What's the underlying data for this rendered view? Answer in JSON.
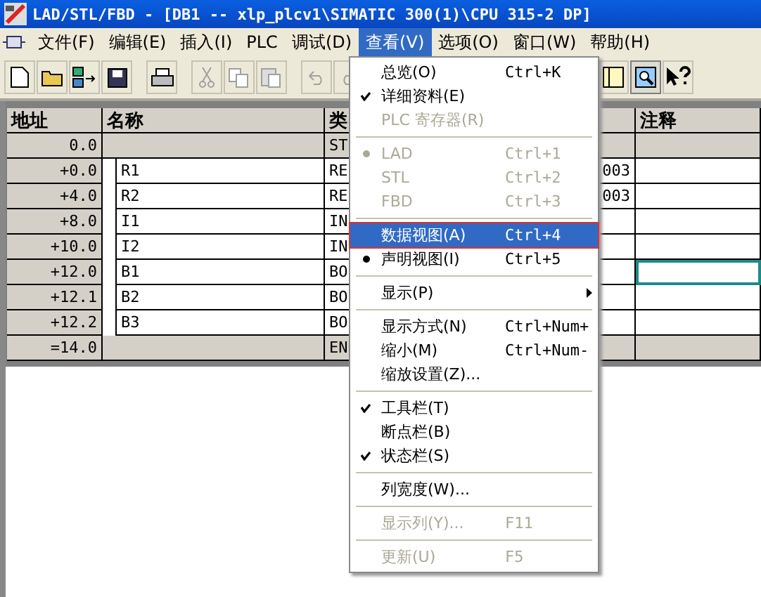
{
  "window": {
    "title": "LAD/STL/FBD  - [DB1 -- xlp_plcv1\\SIMATIC 300(1)\\CPU 315-2 DP]"
  },
  "menu_bar": [
    {
      "label": "文件(F)",
      "selected": false
    },
    {
      "label": "编辑(E)",
      "selected": false
    },
    {
      "label": "插入(I)",
      "selected": false
    },
    {
      "label": "PLC",
      "selected": false
    },
    {
      "label": "调试(D)",
      "selected": false
    },
    {
      "label": "查看(V)",
      "selected": true
    },
    {
      "label": "选项(O)",
      "selected": false
    },
    {
      "label": "窗口(W)",
      "selected": false
    },
    {
      "label": "帮助(H)",
      "selected": false
    }
  ],
  "toolbar": [
    {
      "kind": "new",
      "disabled": false
    },
    {
      "kind": "open",
      "disabled": false
    },
    {
      "kind": "download",
      "disabled": false
    },
    {
      "kind": "save",
      "disabled": false
    },
    {
      "kind": "gap"
    },
    {
      "kind": "print",
      "disabled": false
    },
    {
      "kind": "gap"
    },
    {
      "kind": "cut",
      "disabled": true
    },
    {
      "kind": "copy",
      "disabled": true
    },
    {
      "kind": "paste",
      "disabled": true
    },
    {
      "kind": "gap"
    },
    {
      "kind": "undo",
      "disabled": true
    },
    {
      "kind": "redo",
      "disabled": true
    }
  ],
  "toolbar_right": [
    {
      "kind": "panel",
      "pressed": false
    },
    {
      "kind": "zoom",
      "pressed": true
    },
    {
      "kind": "help",
      "pressed": false
    }
  ],
  "table": {
    "columns": [
      "地址",
      "名称",
      "类",
      "",
      ""
    ],
    "last_column": "注释",
    "rows": [
      {
        "address": "0.0",
        "name": "",
        "type": "ST",
        "column_4": "",
        "kind": "struct"
      },
      {
        "address": "+0.0",
        "name": "R1",
        "type": "RE",
        "column_4": "003",
        "kind": "entry"
      },
      {
        "address": "+4.0",
        "name": "R2",
        "type": "RE",
        "column_4": "003",
        "kind": "entry"
      },
      {
        "address": "+8.0",
        "name": "I1",
        "type": "IN",
        "column_4": "",
        "kind": "entry"
      },
      {
        "address": "+10.0",
        "name": "I2",
        "type": "IN",
        "column_4": "",
        "kind": "entry"
      },
      {
        "address": "+12.0",
        "name": "B1",
        "type": "BO",
        "column_4": "",
        "kind": "entry",
        "selected": true
      },
      {
        "address": "+12.1",
        "name": "B2",
        "type": "BO",
        "column_4": "",
        "kind": "entry",
        "selected": false
      },
      {
        "address": "+12.2",
        "name": "B3",
        "type": "BO",
        "column_4": "",
        "kind": "entry",
        "selected": false
      },
      {
        "address": "=14.0",
        "name": "",
        "type": "EN",
        "column_4": "",
        "kind": "struct"
      }
    ]
  },
  "view_menu": [
    {
      "kind": "item",
      "label": "总览(O)",
      "shortcut": "Ctrl+K",
      "checked": false,
      "radio": false,
      "disabled": false,
      "selected": false
    },
    {
      "kind": "item",
      "label": "详细资料(E)",
      "checked": true,
      "radio": false,
      "disabled": false,
      "selected": false
    },
    {
      "kind": "item",
      "label": "PLC 寄存器(R)",
      "checked": false,
      "radio": false,
      "disabled": true,
      "selected": false
    },
    {
      "kind": "separator"
    },
    {
      "kind": "item",
      "label": "LAD",
      "shortcut": "Ctrl+1",
      "checked": false,
      "radio": true,
      "disabled": true,
      "selected": false
    },
    {
      "kind": "item",
      "label": "STL",
      "shortcut": "Ctrl+2",
      "checked": false,
      "radio": false,
      "disabled": true,
      "selected": false
    },
    {
      "kind": "item",
      "label": "FBD",
      "shortcut": "Ctrl+3",
      "checked": false,
      "radio": false,
      "disabled": true,
      "selected": false
    },
    {
      "kind": "separator"
    },
    {
      "kind": "item",
      "label": "数据视图(A)",
      "shortcut": "Ctrl+4",
      "checked": false,
      "radio": false,
      "disabled": false,
      "selected": true
    },
    {
      "kind": "item",
      "label": "声明视图(I)",
      "shortcut": "Ctrl+5",
      "checked": false,
      "radio": true,
      "disabled": false,
      "selected": false
    },
    {
      "kind": "separator"
    },
    {
      "kind": "item",
      "label": "显示(P)",
      "submenu": true,
      "checked": false,
      "radio": false,
      "disabled": false,
      "selected": false
    },
    {
      "kind": "separator"
    },
    {
      "kind": "item",
      "label": "显示方式(N)",
      "shortcut": "Ctrl+Num+",
      "checked": false,
      "radio": false,
      "disabled": false,
      "selected": false
    },
    {
      "kind": "item",
      "label": "缩小(M)",
      "shortcut": "Ctrl+Num-",
      "checked": false,
      "radio": false,
      "disabled": false,
      "selected": false
    },
    {
      "kind": "item",
      "label": "缩放设置(Z)...",
      "checked": false,
      "radio": false,
      "disabled": false,
      "selected": false
    },
    {
      "kind": "separator"
    },
    {
      "kind": "item",
      "label": "工具栏(T)",
      "checked": true,
      "radio": false,
      "disabled": false,
      "selected": false
    },
    {
      "kind": "item",
      "label": "断点栏(B)",
      "checked": false,
      "radio": false,
      "disabled": false,
      "selected": false
    },
    {
      "kind": "item",
      "label": "状态栏(S)",
      "checked": true,
      "radio": false,
      "disabled": false,
      "selected": false
    },
    {
      "kind": "separator"
    },
    {
      "kind": "item",
      "label": "列宽度(W)...",
      "checked": false,
      "radio": false,
      "disabled": false,
      "selected": false
    },
    {
      "kind": "separator"
    },
    {
      "kind": "item",
      "label": "显示列(Y)...",
      "shortcut": "F11",
      "checked": false,
      "radio": false,
      "disabled": true,
      "selected": false
    },
    {
      "kind": "separator"
    },
    {
      "kind": "item",
      "label": "更新(U)",
      "shortcut": "F5",
      "checked": false,
      "radio": false,
      "disabled": true,
      "selected": false
    }
  ]
}
